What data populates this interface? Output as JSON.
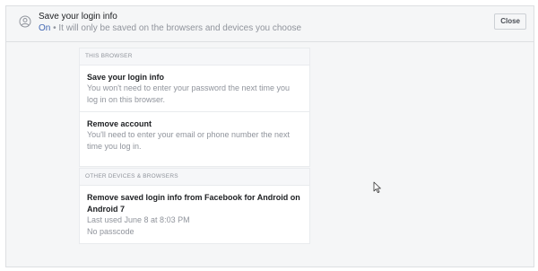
{
  "header": {
    "title": "Save your login info",
    "status": "On",
    "separator": " • ",
    "subtitle": "It will only be saved on the browsers and devices you choose",
    "close_label": "Close"
  },
  "this_browser": {
    "section_label": "THIS BROWSER",
    "items": [
      {
        "title": "Save your login info",
        "description": "You won't need to enter your password the next time you log in on this browser."
      },
      {
        "title": "Remove account",
        "description": "You'll need to enter your email or phone number the next time you log in."
      }
    ]
  },
  "other_devices": {
    "section_label": "OTHER DEVICES & BROWSERS",
    "items": [
      {
        "title": "Remove saved login info from Facebook for Android on Android 7",
        "last_used": "Last used June 8 at 8:03 PM",
        "passcode": "No passcode"
      }
    ]
  }
}
